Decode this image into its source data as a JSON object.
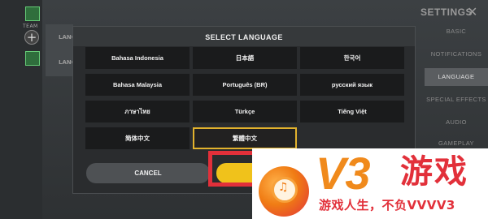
{
  "left_panel": {
    "team_label": "TEAM",
    "add_symbol": "+"
  },
  "header": {
    "title": "SETTINGS",
    "close_symbol": "✕"
  },
  "side_tabs": [
    {
      "label": "BASIC",
      "active": false
    },
    {
      "label": "NOTIFICATIONS",
      "active": false
    },
    {
      "label": "LANGUAGE",
      "active": true
    },
    {
      "label": "SPECIAL EFFECTS",
      "active": false
    },
    {
      "label": "AUDIO",
      "active": false
    },
    {
      "label": "GAMEPLAY",
      "active": false
    }
  ],
  "background_panel": {
    "label_1": "LANG",
    "label_2": "LANG"
  },
  "modal": {
    "title": "SELECT LANGUAGE",
    "languages": [
      {
        "label": "Bahasa Indonesia",
        "selected": false
      },
      {
        "label": "日本語",
        "selected": false
      },
      {
        "label": "한국어",
        "selected": false
      },
      {
        "label": "Bahasa Malaysia",
        "selected": false
      },
      {
        "label": "Português (BR)",
        "selected": false
      },
      {
        "label": "русский язык",
        "selected": false
      },
      {
        "label": "ภาษาไทย",
        "selected": false
      },
      {
        "label": "Türkçe",
        "selected": false
      },
      {
        "label": "Tiếng Việt",
        "selected": false
      },
      {
        "label": "简体中文",
        "selected": false
      },
      {
        "label": "繁體中文",
        "selected": true
      }
    ],
    "cancel_label": "CANCEL",
    "confirm_label": ""
  },
  "watermark": {
    "brand": "V3",
    "brand_cn": "游戏",
    "slogan": "游戏人生，不负VVVV3",
    "colors": {
      "orange": "#f08a1c",
      "red": "#e2303a"
    }
  },
  "colors": {
    "accent": "#e2b22d",
    "confirm": "#f0c21b",
    "highlight": "#e2303a"
  }
}
